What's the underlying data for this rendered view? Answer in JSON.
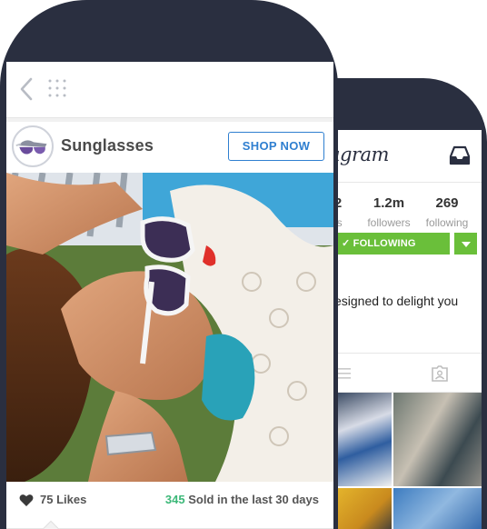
{
  "colors": {
    "phone_frame": "#2a2f40",
    "shop_accent": "#2f7fd0",
    "follow_green": "#6abf3a",
    "sold_highlight": "#3cb878"
  },
  "front_screen": {
    "nav": {
      "back_icon": "chevron-left-icon",
      "menu_icon": "grid-dots-icon"
    },
    "post": {
      "title": "Sunglasses",
      "shop_button": "SHOP NOW",
      "photo_icon": "photo",
      "likes_label": "75 Likes",
      "sold_count": "345",
      "sold_text": "Sold in the last 30 days"
    }
  },
  "back_screen": {
    "brand": "agram",
    "inbox_icon": "inbox-icon",
    "stats": [
      {
        "value": "2",
        "label": "ts"
      },
      {
        "value": "1.2m",
        "label": "followers"
      },
      {
        "value": "269",
        "label": "following"
      }
    ],
    "follow_button": "✓ FOLLOWING",
    "bio": "esigned to delight you"
  }
}
